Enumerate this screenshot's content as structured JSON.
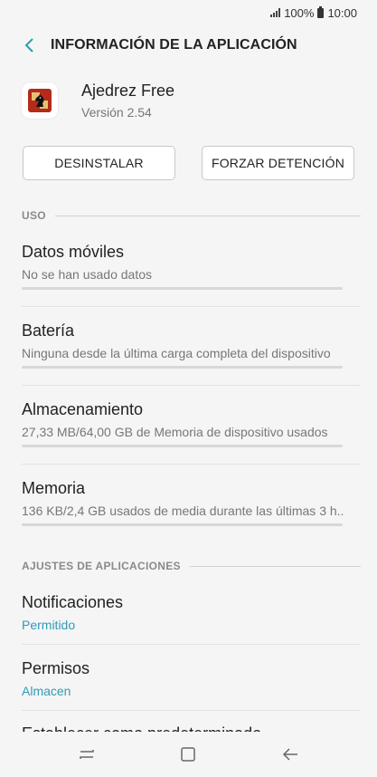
{
  "status_bar": {
    "battery": "100%",
    "time": "10:00"
  },
  "app_bar": {
    "title": "INFORMACIÓN DE LA APLICACIÓN"
  },
  "app": {
    "name": "Ajedrez Free",
    "version": "Versión 2.54"
  },
  "buttons": {
    "uninstall": "DESINSTALAR",
    "force_stop": "FORZAR DETENCIÓN"
  },
  "usage": {
    "header": "USO",
    "items": [
      {
        "title": "Datos móviles",
        "subtitle": "No se han usado datos"
      },
      {
        "title": "Batería",
        "subtitle": "Ninguna desde la última carga completa del dispositivo"
      },
      {
        "title": "Almacenamiento",
        "subtitle": "27,33 MB/64,00 GB de Memoria de dispositivo usados"
      },
      {
        "title": "Memoria",
        "subtitle": "136 KB/2,4 GB usados de media durante las últimas 3 h.."
      }
    ]
  },
  "app_settings": {
    "header": "AJUSTES DE APLICACIONES",
    "items": [
      {
        "title": "Notificaciones",
        "subtitle": "Permitido"
      },
      {
        "title": "Permisos",
        "subtitle": "Almacen"
      },
      {
        "title": "Establecer como predeterminado"
      }
    ]
  },
  "colors": {
    "accent": "#2f9bb5",
    "back_arrow": "#2f9bb5"
  }
}
